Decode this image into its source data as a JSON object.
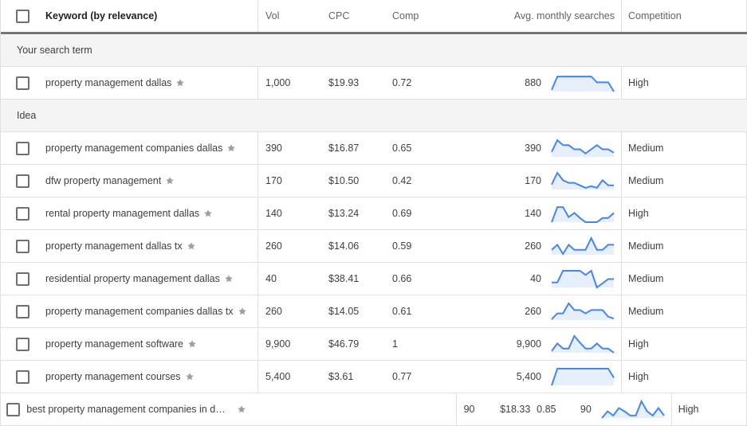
{
  "header": {
    "select_all_checked": false,
    "keyword": "Keyword (by relevance)",
    "vol": "Vol",
    "cpc": "CPC",
    "comp": "Comp",
    "avg_monthly": "Avg. monthly searches",
    "competition": "Competition"
  },
  "icons": {
    "star": "star-icon",
    "checkbox": "checkbox-unchecked"
  },
  "colors": {
    "spark_line": "#4285f4",
    "spark_fill": "#e8effc",
    "header_rule": "#757575",
    "group_bg": "#f4f4f4"
  },
  "groups": [
    {
      "label": "Your search term",
      "rows": [
        {
          "keyword": "property management dallas",
          "vol": "1,000",
          "cpc": "$19.93",
          "comp": "0.72",
          "avg": "880",
          "competition": "High",
          "trend": [
            0.1,
            0.9,
            0.9,
            0.9,
            0.9,
            0.9,
            0.9,
            0.9,
            0.55,
            0.55,
            0.55,
            0.0
          ]
        }
      ]
    },
    {
      "label": "Idea",
      "rows": [
        {
          "keyword": "property management companies dallas",
          "vol": "390",
          "cpc": "$16.87",
          "comp": "0.65",
          "avg": "390",
          "competition": "Medium",
          "trend": [
            0.3,
            1.0,
            0.7,
            0.7,
            0.45,
            0.45,
            0.2,
            0.45,
            0.7,
            0.45,
            0.45,
            0.25
          ]
        },
        {
          "keyword": "dfw property management",
          "vol": "170",
          "cpc": "$10.50",
          "comp": "0.42",
          "avg": "170",
          "competition": "Medium",
          "trend": [
            0.3,
            1.0,
            0.55,
            0.4,
            0.4,
            0.25,
            0.1,
            0.2,
            0.1,
            0.55,
            0.25,
            0.25
          ]
        },
        {
          "keyword": "rental property management dallas",
          "vol": "140",
          "cpc": "$13.24",
          "comp": "0.69",
          "avg": "140",
          "competition": "High",
          "trend": [
            0.0,
            0.9,
            0.9,
            0.3,
            0.55,
            0.25,
            0.0,
            0.0,
            0.0,
            0.25,
            0.25,
            0.55
          ]
        },
        {
          "keyword": "property management dallas tx",
          "vol": "260",
          "cpc": "$14.06",
          "comp": "0.59",
          "avg": "260",
          "competition": "Medium",
          "trend": [
            0.3,
            0.6,
            0.05,
            0.6,
            0.3,
            0.3,
            0.3,
            1.0,
            0.3,
            0.3,
            0.6,
            0.6
          ]
        },
        {
          "keyword": "residential property management dallas",
          "vol": "40",
          "cpc": "$38.41",
          "comp": "0.66",
          "avg": "40",
          "competition": "Medium",
          "trend": [
            0.3,
            0.3,
            1.0,
            1.0,
            1.0,
            1.0,
            0.75,
            1.0,
            0.0,
            0.25,
            0.5,
            0.5
          ]
        },
        {
          "keyword": "property management companies dallas tx",
          "vol": "260",
          "cpc": "$14.05",
          "comp": "0.61",
          "avg": "260",
          "competition": "Medium",
          "trend": [
            0.05,
            0.4,
            0.4,
            1.0,
            0.6,
            0.6,
            0.4,
            0.6,
            0.6,
            0.6,
            0.2,
            0.1
          ]
        },
        {
          "keyword": "property management software",
          "vol": "9,900",
          "cpc": "$46.79",
          "comp": "1",
          "avg": "9,900",
          "competition": "High",
          "trend": [
            0.1,
            0.55,
            0.25,
            0.25,
            1.0,
            0.6,
            0.25,
            0.25,
            0.55,
            0.25,
            0.25,
            0.0
          ]
        },
        {
          "keyword": "property management courses",
          "vol": "5,400",
          "cpc": "$3.61",
          "comp": "0.77",
          "avg": "5,400",
          "competition": "High",
          "trend": [
            0.0,
            1.0,
            1.0,
            1.0,
            1.0,
            1.0,
            1.0,
            1.0,
            1.0,
            1.0,
            1.0,
            0.45
          ]
        },
        {
          "keyword": "best property management companies in d...",
          "vol": "90",
          "cpc": "$18.33",
          "comp": "0.85",
          "avg": "90",
          "competition": "High",
          "trend": [
            0.0,
            0.4,
            0.15,
            0.6,
            0.4,
            0.15,
            0.15,
            1.0,
            0.4,
            0.15,
            0.6,
            0.15
          ]
        }
      ]
    }
  ]
}
